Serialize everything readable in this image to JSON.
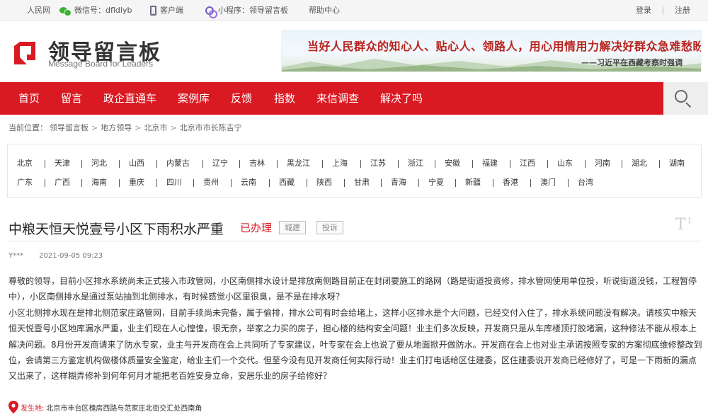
{
  "topbar": {
    "site": "人民网",
    "wechat": "微信号：dfldlyb",
    "client": "客户端",
    "miniapp": "小程序：领导留言板",
    "help": "帮助中心",
    "login": "登录",
    "register": "注册"
  },
  "header": {
    "logo_title": "领导留言板",
    "logo_sub": "Message Board for Leaders",
    "banner_text": "当好人民群众的知心人、贴心人、领路人，用心用情用力解决好群众急难愁盼问题。",
    "banner_sign": "——习近平在西藏考察时强调"
  },
  "nav": {
    "items": [
      "首页",
      "留言",
      "政企直通车",
      "案例库",
      "反馈",
      "指数",
      "来信调查",
      "解决了吗"
    ]
  },
  "breadcrumb": {
    "prefix": "当前位置：",
    "items": [
      "领导留言板",
      "地方领导",
      "北京市",
      "北京市市长陈吉宁"
    ]
  },
  "regions": {
    "row1": [
      "北京",
      "天津",
      "河北",
      "山西",
      "内蒙古",
      "辽宁",
      "吉林",
      "黑龙江",
      "上海",
      "江苏",
      "浙江",
      "安徽",
      "福建",
      "江西",
      "山东",
      "河南",
      "湖北",
      "湖南"
    ],
    "row2": [
      "广东",
      "广西",
      "海南",
      "重庆",
      "四川",
      "贵州",
      "云南",
      "西藏",
      "陕西",
      "甘肃",
      "青海",
      "宁夏",
      "新疆",
      "香港",
      "澳门",
      "台湾"
    ]
  },
  "post": {
    "title": "中粮天恒天悦壹号小区下雨积水严重",
    "status": "已办理",
    "tags": [
      "城建",
      "投诉"
    ],
    "font_toggle": "T",
    "author": "Y***",
    "date": "2021-09-05 09:23",
    "paragraphs": [
      "尊敬的领导，目前小区排水系统尚未正式接入市政管网，小区南侧排水设计是排放南侧路目前正在封闭要施工的路网（路是街道投资修，排水管网使用单位投，听说街道没钱，工程暂停中），小区南侧排水是通过泵站抽到北侧排水，有时候感觉小区里很臭，是不是在排水呀？",
      "小区北侧排水现在是排北侧范家庄路管网，目前手续尚未完备，属于偷排，排水公司有时会给堵上，这样小区排水是个大问题，已经交付入住了，排水系统问题没有解决。请核实中粮天恒天悦壹号小区地库漏水严重，业主们现在人心惶惶，很无奈，举家之力买的房子，担心楼的结构安全问题！业主们多次反映，开发商只是从车库楼顶打胶堵漏，这种修法不能从根本上解决问题。8月份开发商请来了防水专家，业主与开发商在会上共同听了专家建议，叶专家在会上也说了要从地面掀开做防水。开发商在会上也对业主承诺按照专家的方案彻底维修整改到位，会请第三方鉴定机构做楼体质量安全鉴定，给业主们一个交代。但至今没有见开发商任何实际行动！业主们打电话给区住建委，区住建委说开发商已经修好了，可是一下雨新的漏点又出来了，这样糊弄修补到何年何月才能把老百姓安身立命，安居乐业的房子给修好？"
    ],
    "location_label": "发生地:",
    "location": "北京市丰台区槐房西路与范家庄北街交汇处西南角"
  },
  "colors": {
    "brand_red": "#d91a23",
    "nav_bg": "#d91a23"
  }
}
